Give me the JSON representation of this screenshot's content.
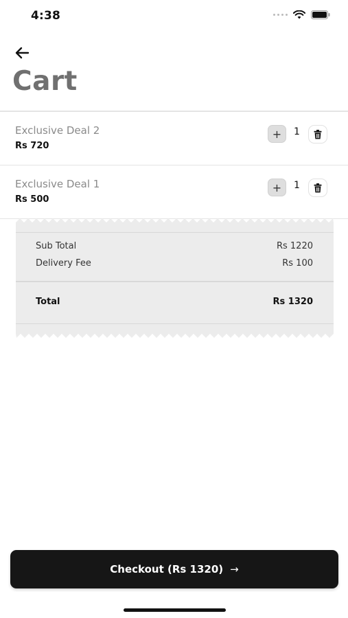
{
  "status_bar": {
    "time": "4:38"
  },
  "header": {
    "title": "Cart"
  },
  "cart_items": [
    {
      "name": "Exclusive Deal 2",
      "price": "Rs 720",
      "quantity": "1",
      "plus_label": "+"
    },
    {
      "name": "Exclusive Deal 1",
      "price": "Rs 500",
      "quantity": "1",
      "plus_label": "+"
    }
  ],
  "summary": {
    "subtotal_label": "Sub Total",
    "subtotal_value": "Rs 1220",
    "delivery_label": "Delivery Fee",
    "delivery_value": "Rs 100",
    "total_label": "Total",
    "total_value": "Rs 1320"
  },
  "checkout": {
    "label": "Checkout (Rs 1320)",
    "arrow": "→"
  },
  "colors": {
    "accent": "#161616",
    "title": "#707070",
    "receipt_bg": "#ececec"
  }
}
